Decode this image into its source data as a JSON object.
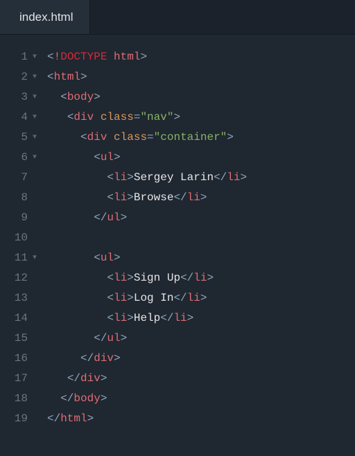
{
  "tab": {
    "label": "index.html"
  },
  "lines": {
    "l1": {
      "num": "1",
      "fold": true
    },
    "l2": {
      "num": "2",
      "fold": true
    },
    "l3": {
      "num": "3",
      "fold": true
    },
    "l4": {
      "num": "4",
      "fold": true
    },
    "l5": {
      "num": "5",
      "fold": true
    },
    "l6": {
      "num": "6",
      "fold": true
    },
    "l7": {
      "num": "7",
      "fold": false
    },
    "l8": {
      "num": "8",
      "fold": false
    },
    "l9": {
      "num": "9",
      "fold": false
    },
    "l10": {
      "num": "10",
      "fold": false
    },
    "l11": {
      "num": "11",
      "fold": true
    },
    "l12": {
      "num": "12",
      "fold": false
    },
    "l13": {
      "num": "13",
      "fold": false
    },
    "l14": {
      "num": "14",
      "fold": false
    },
    "l15": {
      "num": "15",
      "fold": false
    },
    "l16": {
      "num": "16",
      "fold": false
    },
    "l17": {
      "num": "17",
      "fold": false
    },
    "l18": {
      "num": "18",
      "fold": false
    },
    "l19": {
      "num": "19",
      "fold": false
    }
  },
  "tok": {
    "lt": "<",
    "gt": ">",
    "lts": "</",
    "eq": "=",
    "bang": "!",
    "doctype": "DOCTYPE",
    "htmlkw": " html",
    "html": "html",
    "body": "body",
    "div": "div",
    "ul": "ul",
    "li": "li",
    "class_attr": " class",
    "q_nav": "\"nav\"",
    "q_container": "\"container\"",
    "txt_sergey": "Sergey Larin",
    "txt_browse": "Browse",
    "txt_signup": "Sign Up",
    "txt_login": "Log In",
    "txt_help": "Help",
    "sp2": "  ",
    "sp3": "   ",
    "sp5": "     ",
    "sp7": "       ",
    "sp9": "         "
  }
}
